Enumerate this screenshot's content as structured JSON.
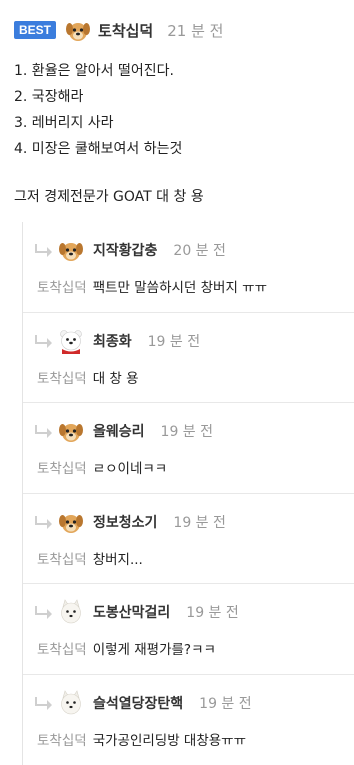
{
  "best": {
    "badge": "BEST",
    "avatar": "puppy-avatar",
    "nickname": "토착십덕",
    "time": "21 분 전",
    "lines": [
      "1. 환율은 알아서 떨어진다.",
      "2. 국장해라",
      "3. 레버리지 사라",
      "4. 미장은 쿨해보여서 하는것"
    ],
    "closing": "그저 경제전문가 GOAT 대 창 용"
  },
  "replies": [
    {
      "avatar": "puppy-avatar",
      "nickname": "지작황갑충",
      "time": "20 분 전",
      "mention": "토착십덕",
      "text": "팩트만 말씀하시던 창버지 ㅠㅠ"
    },
    {
      "avatar": "polar-bear-avatar",
      "nickname": "최종화",
      "time": "19 분 전",
      "mention": "토착십덕",
      "text": "대 창 용"
    },
    {
      "avatar": "puppy-avatar",
      "nickname": "올웨승리",
      "time": "19 분 전",
      "mention": "토착십덕",
      "text": "ㄹㅇ이네ㅋㅋ"
    },
    {
      "avatar": "puppy-avatar",
      "nickname": "정보청소기",
      "time": "19 분 전",
      "mention": "토착십덕",
      "text": "창버지..."
    },
    {
      "avatar": "white-dog-avatar",
      "nickname": "도봉산막걸리",
      "time": "19 분 전",
      "mention": "토착십덕",
      "text": "이렇게 재평가를?ㅋㅋ"
    },
    {
      "avatar": "white-dog-avatar",
      "nickname": "슬석열당장탄핵",
      "time": "19 분 전",
      "mention": "토착십덕",
      "text": "국가공인리딩방 대창용ㅠㅠ"
    }
  ],
  "colors": {
    "badge": "#3b7ddd",
    "muted": "#999999",
    "text": "#222222",
    "divider": "#e8e8e8"
  }
}
